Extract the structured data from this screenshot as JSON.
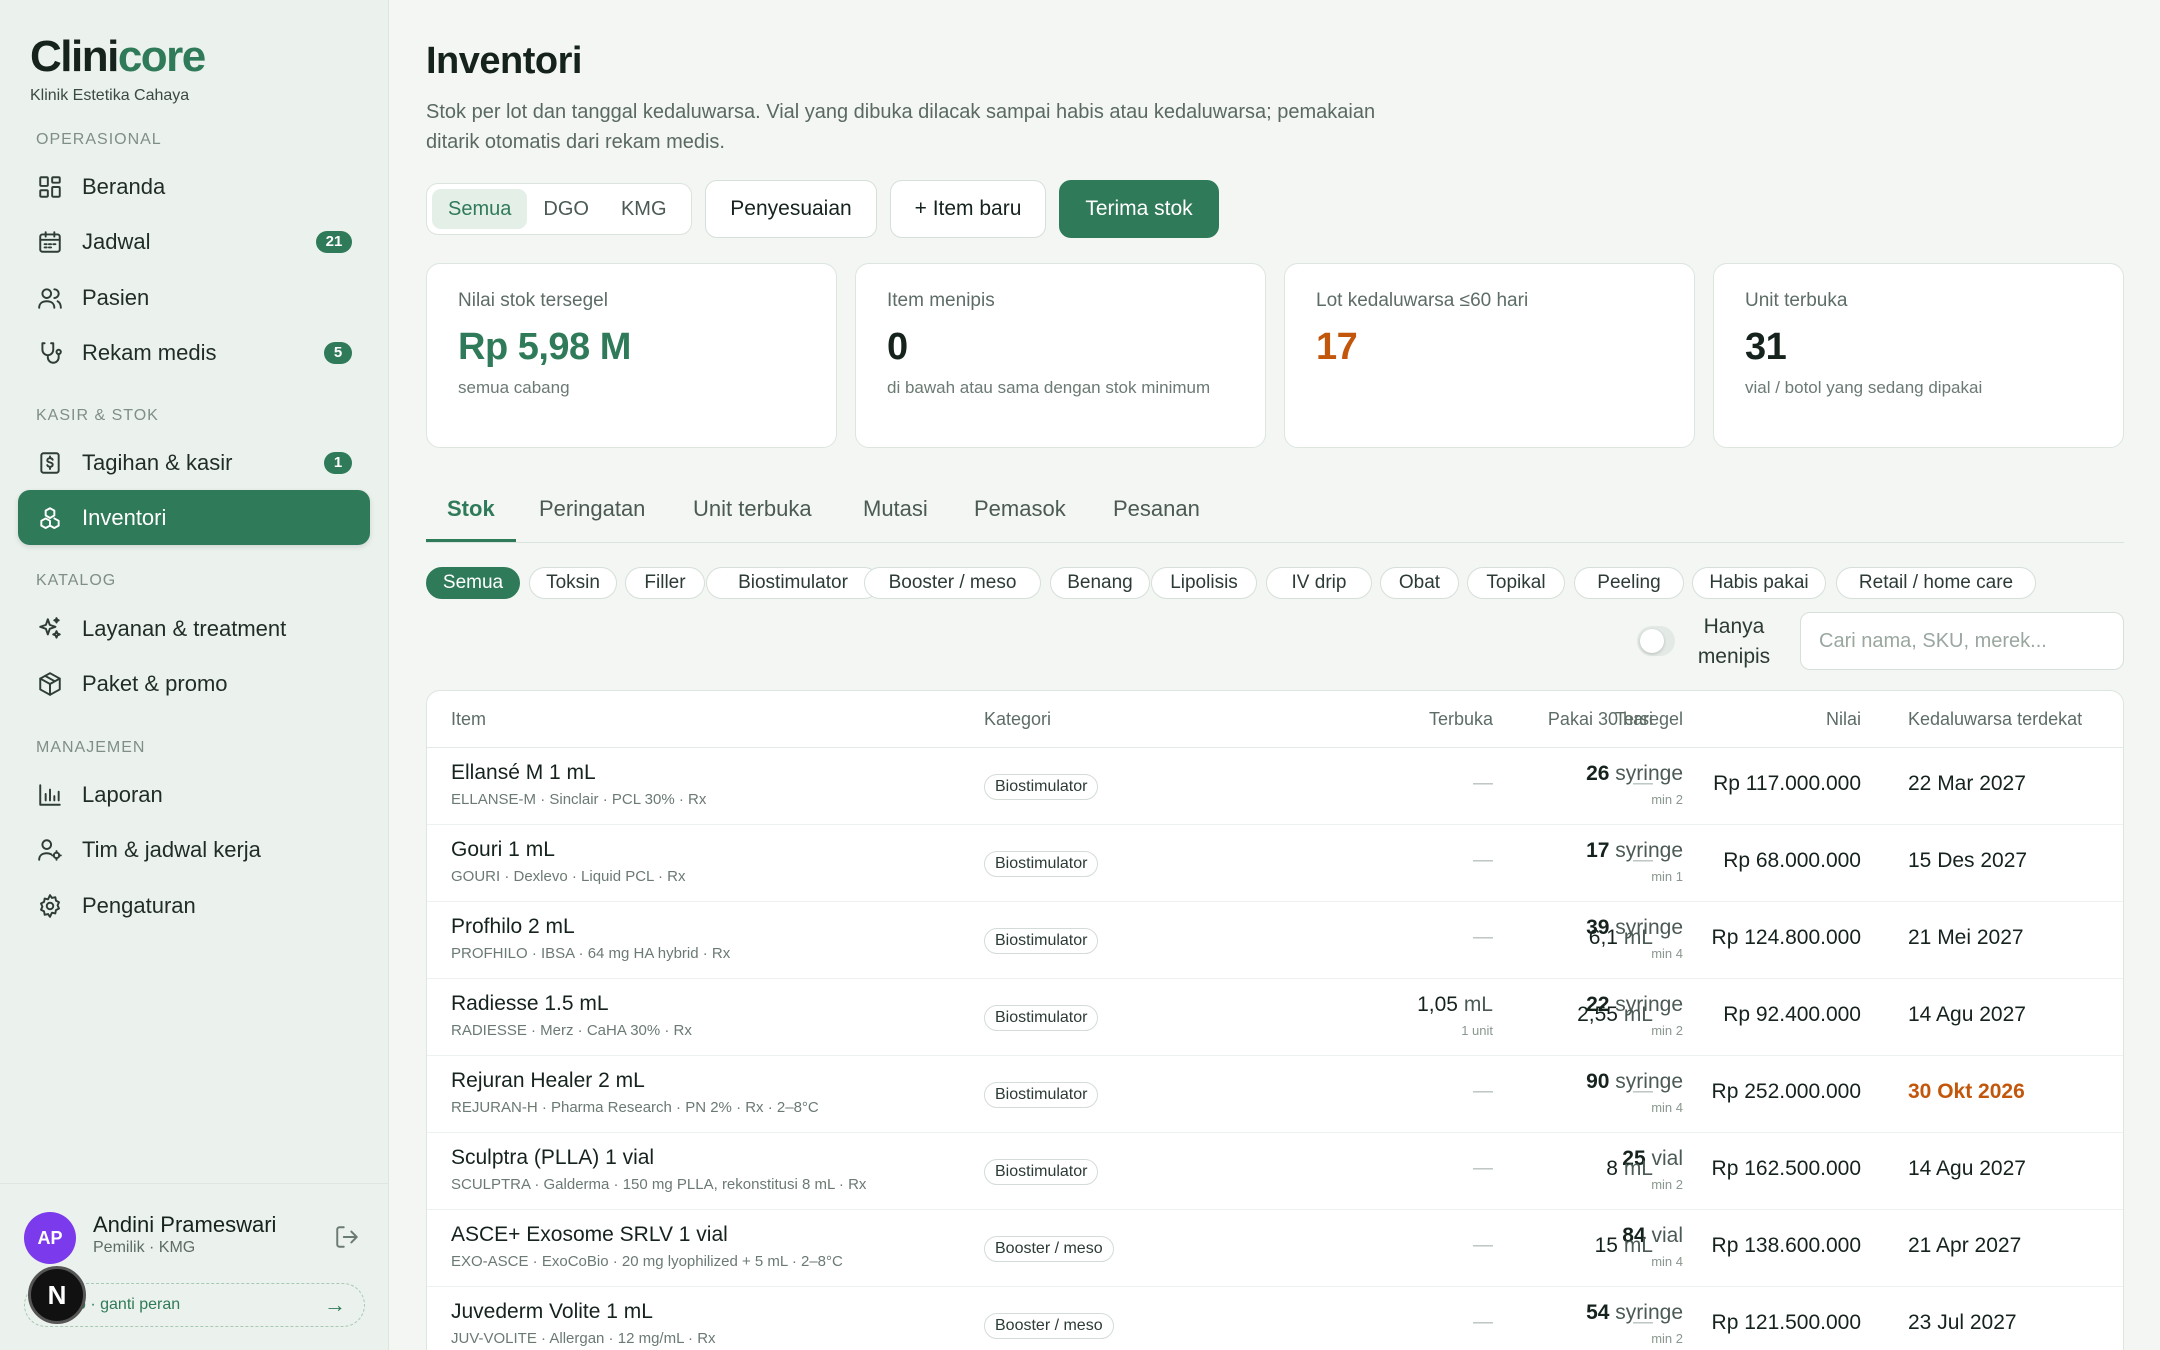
{
  "sidebar": {
    "logo_main": "Clini",
    "logo_accent": "core",
    "clinic": "Klinik Estetika Cahaya",
    "sections": {
      "operasional": "OPERASIONAL",
      "kasir": "KASIR & STOK",
      "katalog": "KATALOG",
      "manajemen": "MANAJEMEN"
    },
    "items": {
      "beranda": "Beranda",
      "jadwal": "Jadwal",
      "jadwal_badge": "21",
      "pasien": "Pasien",
      "rekam": "Rekam medis",
      "rekam_badge": "5",
      "tagihan": "Tagihan & kasir",
      "tagihan_badge": "1",
      "inventori": "Inventori",
      "layanan": "Layanan & treatment",
      "paket": "Paket & promo",
      "laporan": "Laporan",
      "tim": "Tim & jadwal kerja",
      "pengaturan": "Pengaturan"
    },
    "user": {
      "initials": "AP",
      "name": "Andini Prameswari",
      "role": "Pemilik · KMG",
      "switch": "o · ganti peran",
      "switch_arrow": "→",
      "overlay": "N"
    }
  },
  "header": {
    "title": "Inventori",
    "description": "Stok per lot dan tanggal kedaluwarsa. Vial yang dibuka dilacak sampai habis atau kedaluwarsa; pemakaian ditarik otomatis dari rekam medis."
  },
  "branch_filter": {
    "options": [
      "Semua",
      "DGO",
      "KMG"
    ],
    "selected": "Semua"
  },
  "actions": {
    "adjust": "Penyesuaian",
    "new_item": "+ Item baru",
    "receive": "Terima stok"
  },
  "stats": [
    {
      "label": "Nilai stok tersegel",
      "value": "Rp 5,98 M",
      "sub": "semua cabang",
      "color": "#2f7a59"
    },
    {
      "label": "Item menipis",
      "value": "0",
      "sub": "di bawah atau sama dengan stok minimum",
      "color": "#15231c"
    },
    {
      "label": "Lot kedaluwarsa ≤60 hari",
      "value": "17",
      "sub": "",
      "color": "#c2570c"
    },
    {
      "label": "Unit terbuka",
      "value": "31",
      "sub": "vial / botol yang sedang dipakai",
      "color": "#15231c"
    }
  ],
  "tabs": [
    "Stok",
    "Peringatan",
    "Unit terbuka",
    "Mutasi",
    "Pemasok",
    "Pesanan"
  ],
  "chips": [
    "Semua",
    "Toksin",
    "Filler",
    "Biostimulator",
    "Booster / meso",
    "Benang",
    "Lipolisis",
    "IV drip",
    "Obat",
    "Topikal",
    "Peeling",
    "Habis pakai",
    "Retail / home care"
  ],
  "filter": {
    "toggle_label": "Hanya menipis",
    "search_placeholder": "Cari nama, SKU, merek..."
  },
  "table": {
    "headers": {
      "item": "Item",
      "kategori": "Kategori",
      "tersegel": "Tersegel",
      "terbuka": "Terbuka",
      "pakai": "Pakai 30 hari",
      "nilai": "Nilai",
      "kedaluwarsa": "Kedaluwarsa terdekat"
    },
    "dash": "—",
    "rows": [
      {
        "name": "Ellansé M 1 mL",
        "meta": "ELLANSE-M · Sinclair · PCL 30% · Rx",
        "category": "Biostimulator",
        "sealed_qty": "26",
        "sealed_unit": "syringe",
        "min": "min 2",
        "open_qty": "",
        "open_unit": "",
        "open_sub": "",
        "usage_qty": "",
        "usage_unit": "",
        "value": "Rp 117.000.000",
        "expiry": "22 Mar 2027",
        "expiry_warn": false
      },
      {
        "name": "Gouri 1 mL",
        "meta": "GOURI · Dexlevo · Liquid PCL · Rx",
        "category": "Biostimulator",
        "sealed_qty": "17",
        "sealed_unit": "syringe",
        "min": "min 1",
        "open_qty": "",
        "open_unit": "",
        "open_sub": "",
        "usage_qty": "",
        "usage_unit": "",
        "value": "Rp 68.000.000",
        "expiry": "15 Des 2027",
        "expiry_warn": false
      },
      {
        "name": "Profhilo 2 mL",
        "meta": "PROFHILO · IBSA · 64 mg HA hybrid · Rx",
        "category": "Biostimulator",
        "sealed_qty": "39",
        "sealed_unit": "syringe",
        "min": "min 4",
        "open_qty": "",
        "open_unit": "",
        "open_sub": "",
        "usage_qty": "6,1",
        "usage_unit": "mL",
        "value": "Rp 124.800.000",
        "expiry": "21 Mei 2027",
        "expiry_warn": false
      },
      {
        "name": "Radiesse 1.5 mL",
        "meta": "RADIESSE · Merz · CaHA 30% · Rx",
        "category": "Biostimulator",
        "sealed_qty": "22",
        "sealed_unit": "syringe",
        "min": "min 2",
        "open_qty": "1,05",
        "open_unit": "mL",
        "open_sub": "1 unit",
        "usage_qty": "2,55",
        "usage_unit": "mL",
        "value": "Rp 92.400.000",
        "expiry": "14 Agu 2027",
        "expiry_warn": false
      },
      {
        "name": "Rejuran Healer 2 mL",
        "meta": "REJURAN-H · Pharma Research · PN 2% · Rx · 2–8°C",
        "category": "Biostimulator",
        "sealed_qty": "90",
        "sealed_unit": "syringe",
        "min": "min 4",
        "open_qty": "",
        "open_unit": "",
        "open_sub": "",
        "usage_qty": "",
        "usage_unit": "",
        "value": "Rp 252.000.000",
        "expiry": "30 Okt 2026",
        "expiry_warn": true
      },
      {
        "name": "Sculptra (PLLA) 1 vial",
        "meta": "SCULPTRA · Galderma · 150 mg PLLA, rekonstitusi 8 mL · Rx",
        "category": "Biostimulator",
        "sealed_qty": "25",
        "sealed_unit": "vial",
        "min": "min 2",
        "open_qty": "",
        "open_unit": "",
        "open_sub": "",
        "usage_qty": "8",
        "usage_unit": "mL",
        "value": "Rp 162.500.000",
        "expiry": "14 Agu 2027",
        "expiry_warn": false
      },
      {
        "name": "ASCE+ Exosome SRLV 1 vial",
        "meta": "EXO-ASCE · ExoCoBio · 20 mg lyophilized + 5 mL · 2–8°C",
        "category": "Booster / meso",
        "sealed_qty": "84",
        "sealed_unit": "vial",
        "min": "min 4",
        "open_qty": "",
        "open_unit": "",
        "open_sub": "",
        "usage_qty": "15",
        "usage_unit": "mL",
        "value": "Rp 138.600.000",
        "expiry": "21 Apr 2027",
        "expiry_warn": false
      },
      {
        "name": "Juvederm Volite 1 mL",
        "meta": "JUV-VOLITE · Allergan · 12 mg/mL · Rx",
        "category": "Booster / meso",
        "sealed_qty": "54",
        "sealed_unit": "syringe",
        "min": "min 2",
        "open_qty": "",
        "open_unit": "",
        "open_sub": "",
        "usage_qty": "",
        "usage_unit": "",
        "value": "Rp 121.500.000",
        "expiry": "23 Jul 2027",
        "expiry_warn": false
      }
    ]
  }
}
